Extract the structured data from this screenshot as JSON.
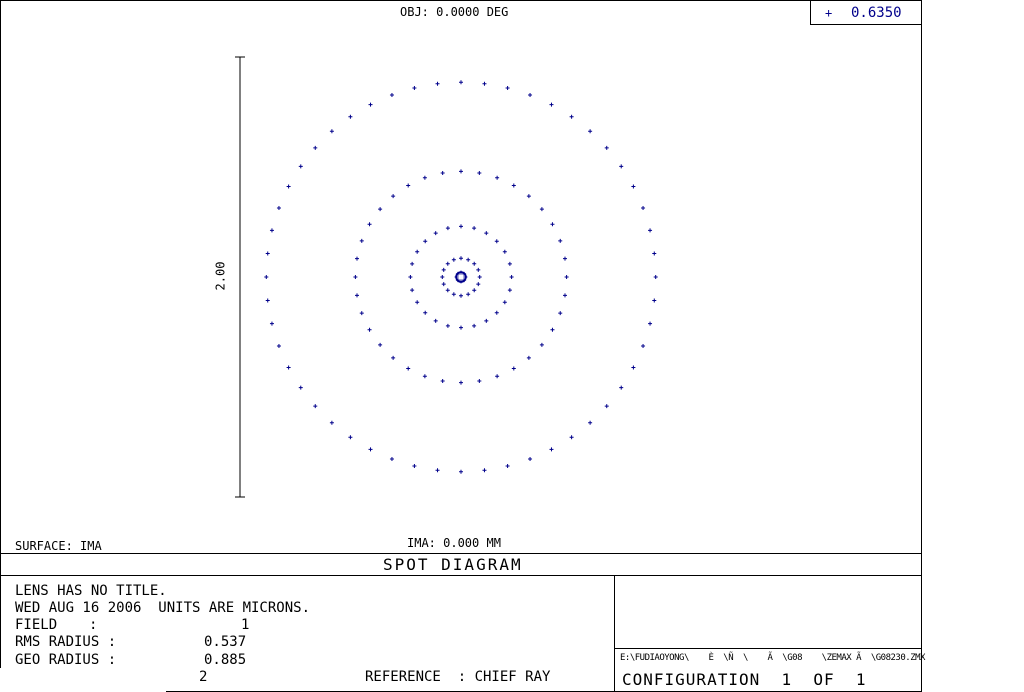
{
  "header": {
    "object_label": "OBJ: 0.0000 DEG",
    "legend_marker": "+",
    "legend_wavelength": "0.6350"
  },
  "plot": {
    "scale_label": "2.00",
    "surface_label": "SURFACE: IMA",
    "image_label": "IMA: 0.000 MM"
  },
  "footer": {
    "title": "SPOT DIAGRAM",
    "lens_title": "LENS HAS NO TITLE.",
    "date_units": "WED AUG 16 2006  UNITS ARE MICRONS.",
    "field_label": "FIELD",
    "field_value": "1",
    "rms_label": "RMS RADIUS :",
    "rms_value": "0.537",
    "geo_label": "GEO RADIUS :",
    "geo_value": "0.885",
    "page_number": "2",
    "reference": "REFERENCE  : CHIEF RAY",
    "file_path": "E:\\FUDIAOYONG\\    È  \\Ñ  \\    Ã  \\G08    \\ZEMAX Ã  \\G08230.ZMX",
    "configuration": "CONFIGURATION  1  OF  1"
  },
  "colors": {
    "spot": "#00008b",
    "frame": "#000000"
  },
  "chart_data": {
    "type": "scatter",
    "title": "SPOT DIAGRAM",
    "units": "MICRONS",
    "marker": "+",
    "series": [
      {
        "name": "0.6350",
        "rings": [
          {
            "radius": 0.885,
            "points": 52
          },
          {
            "radius": 0.48,
            "points": 36
          },
          {
            "radius": 0.23,
            "points": 24
          },
          {
            "radius": 0.085,
            "points": 16
          },
          {
            "radius": 0.02,
            "points": 8
          }
        ]
      }
    ],
    "scale_bar": 2.0,
    "xlim": [
      -1.0,
      1.0
    ],
    "ylim": [
      -1.0,
      1.0
    ]
  }
}
